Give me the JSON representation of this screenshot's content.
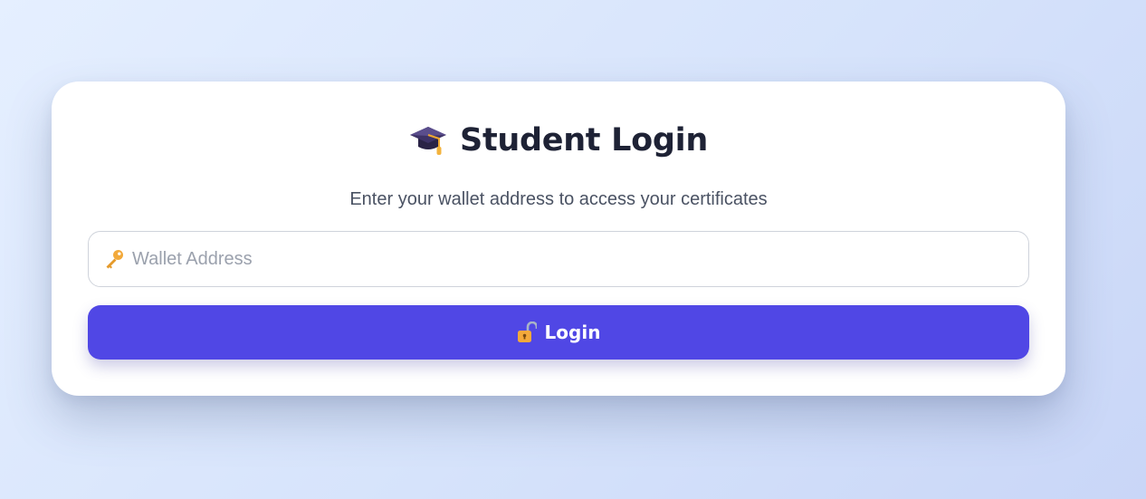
{
  "login": {
    "title": "Student Login",
    "subtitle": "Enter your wallet address to access your certificates",
    "wallet_input": {
      "placeholder": "Wallet Address",
      "value": "",
      "icon": "key-icon"
    },
    "login_button": {
      "label": "Login",
      "icon": "unlocked-lock-icon"
    },
    "title_icon": "graduation-cap-icon"
  },
  "colors": {
    "accent": "#5047e5",
    "title": "#1e2235",
    "subtitle": "#4a5263",
    "placeholder": "#9ba1ad",
    "card": "#ffffff"
  }
}
